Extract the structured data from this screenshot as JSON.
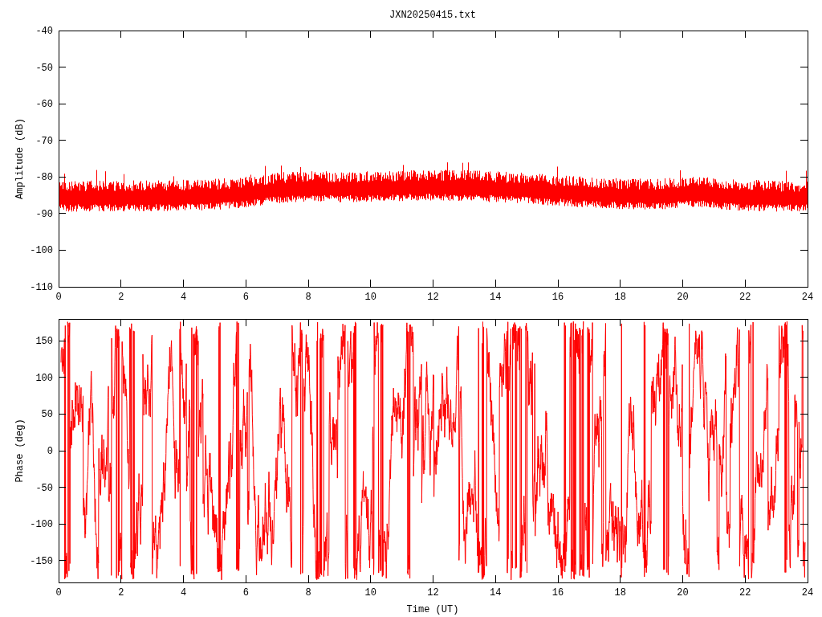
{
  "title": "JXN20250415.txt",
  "panels": [
    {
      "kind": "amplitude",
      "ylabel": "Amplitude (dB)",
      "yticks": [
        "-40",
        "-50",
        "-60",
        "-70",
        "-80",
        "-90",
        "-100",
        "-110"
      ],
      "xticks": [
        "0",
        "2",
        "4",
        "6",
        "8",
        "10",
        "12",
        "14",
        "16",
        "18",
        "20",
        "22",
        "24"
      ]
    },
    {
      "kind": "phase",
      "ylabel": "Phase (deg)",
      "yticks": [
        "150",
        "100",
        "50",
        "0",
        "-50",
        "-100",
        "-150"
      ],
      "xticks": [
        "0",
        "2",
        "4",
        "6",
        "8",
        "10",
        "12",
        "14",
        "16",
        "18",
        "20",
        "22",
        "24"
      ],
      "xlabel": "Time (UT)"
    }
  ]
}
